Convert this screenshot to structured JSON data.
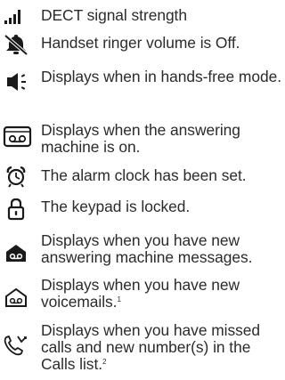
{
  "icon_legend": [
    {
      "icon": "dect-signal-strength-icon",
      "text": "DECT signal strength"
    },
    {
      "icon": "ringer-off-icon",
      "text": "Handset ringer volume is Off."
    },
    {
      "icon": "speaker-icon",
      "text": "Displays when in hands-free mode."
    },
    {
      "icon": "answering-machine-icon",
      "text": "Displays when the answering machine is on."
    },
    {
      "icon": "alarm-clock-icon",
      "text": "The alarm clock has been set."
    },
    {
      "icon": "keypad-lock-icon",
      "text": "The keypad is locked."
    },
    {
      "icon": "new-answering-machine-message-icon",
      "text": "Displays when you have new answering machine messages."
    },
    {
      "icon": "new-voicemail-icon",
      "text": "Displays when you have new voicemails.",
      "footnote": "1"
    },
    {
      "icon": "missed-calls-icon",
      "text": "Displays when you have missed calls and new number(s) in the Calls list.",
      "footnote": "2"
    }
  ],
  "colors": {
    "text": "#2b2b2b",
    "icon": "#1a1a1a"
  }
}
